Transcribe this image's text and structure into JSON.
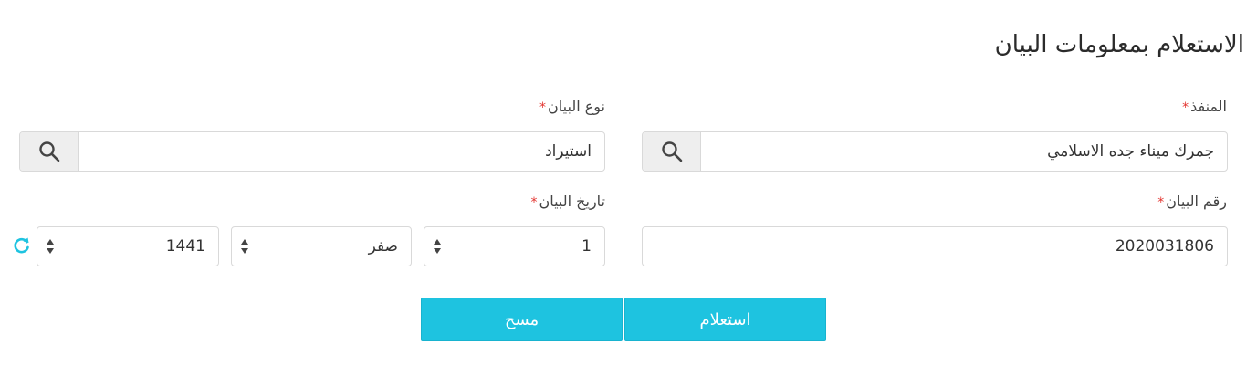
{
  "page": {
    "title": "الاستعلام بمعلومات البيان"
  },
  "form": {
    "port": {
      "label": "المنفذ",
      "value": "جمرك ميناء جده الاسلامي"
    },
    "declaration_type": {
      "label": "نوع البيان",
      "value": "استيراد"
    },
    "declaration_number": {
      "label": "رقم البيان",
      "value": "2020031806"
    },
    "declaration_date": {
      "label": "تاريخ البيان",
      "day": "1",
      "month": "صفر",
      "year": "1441"
    },
    "required_mark": "*"
  },
  "buttons": {
    "inquire": "استعلام",
    "clear": "مسح"
  },
  "colors": {
    "accent": "#1ec3e0",
    "required": "#e3342f",
    "refresh": "#1ec3e0"
  },
  "icons": {
    "search": "search-icon",
    "spinner": "spinner-arrows-icon",
    "refresh": "refresh-icon"
  }
}
